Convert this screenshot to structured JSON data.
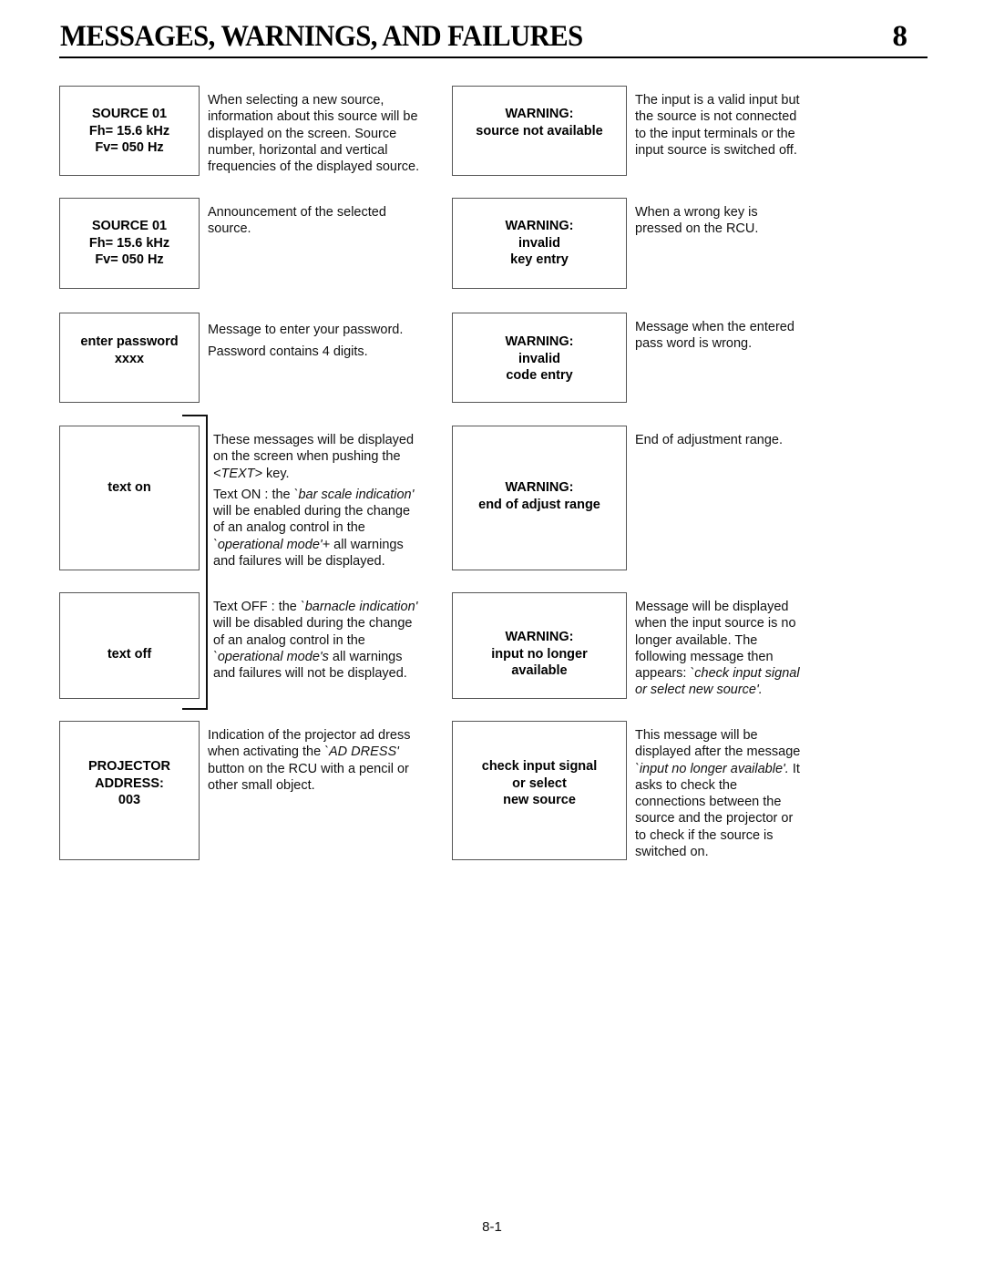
{
  "header": {
    "title": "MESSAGES, WARNINGS, AND FAILURES",
    "chapter": "8"
  },
  "left_column": [
    {
      "box_lines": [
        "SOURCE 01",
        "Fh= 15.6 kHz",
        "Fv= 050 Hz"
      ],
      "description": [
        "When selecting a new source,",
        "information about this source will be",
        "displayed on the screen. Source",
        "number, horizontal and vertical",
        "frequencies of the displayed source."
      ]
    },
    {
      "box_lines": [
        "SOURCE 01",
        "Fh= 15.6 kHz",
        "Fv= 050 Hz"
      ],
      "description": [
        "Announcement of the selected",
        "source."
      ]
    },
    {
      "box_lines": [
        "enter password",
        "xxxx"
      ],
      "description": [
        "Message to enter your password.",
        "Password contains 4 digits."
      ]
    },
    {
      "box_lines": [
        "text on"
      ],
      "description_intro": {
        "line1": "These messages will be displayed",
        "line2": "on the screen when pushing the",
        "key_italic": "<TEXT>",
        "key_suffix": " key."
      },
      "description_detail": {
        "prefix": "Text ON : the ",
        "italic1": "`bar scale indication'",
        "line2": "will be enabled during the change",
        "line3": "of an analog control in the",
        "italic2": "`operational mode'+",
        "suffix2": " all warnings",
        "line5": "and failures will be displayed."
      }
    },
    {
      "box_lines": [
        "text off"
      ],
      "description_detail": {
        "prefix": "Text OFF : the ",
        "italic1": "`barnacle indication'",
        "line2": "will be disabled during the change",
        "line3": "of an analog control in the",
        "italic2": "`operational mode's",
        "suffix2": " all warnings",
        "line5": "and failures will not be displayed."
      }
    },
    {
      "box_lines": [
        "PROJECTOR",
        "ADDRESS:",
        "003"
      ],
      "description_detail": {
        "line1": "Indication of the projector ad dress",
        "prefix2": "when activating the ",
        "italic": "`AD DRESS'",
        "line3": "button on the RCU with a pencil or",
        "line4": "other small object."
      }
    }
  ],
  "right_column": [
    {
      "box_lines": [
        "WARNING:",
        "source not available"
      ],
      "description": [
        "The input is a valid input but",
        "the source is not connected",
        "to the input terminals or the",
        "input source is switched off."
      ]
    },
    {
      "box_lines": [
        "WARNING:",
        "invalid",
        "key entry"
      ],
      "description": [
        "When a wrong key is",
        "pressed on the RCU."
      ]
    },
    {
      "box_lines": [
        "WARNING:",
        "invalid",
        "code entry"
      ],
      "description": [
        "Message when the entered",
        "pass word is wrong."
      ]
    },
    {
      "box_lines": [
        "WARNING:",
        "end of adjust range"
      ],
      "description": [
        "End of adjustment range."
      ]
    },
    {
      "box_lines": [
        "WARNING:",
        "input no longer",
        "available"
      ],
      "description_detail": {
        "line1": "Message will be displayed",
        "line2": "when the input source is no",
        "line3": "longer available. The",
        "line4": "following message then",
        "prefix5": "appears: ",
        "italic5": "`check input signal",
        "italic6": "or select new source'."
      }
    },
    {
      "box_lines": [
        "check input signal",
        "or select",
        "new source"
      ],
      "description_detail": {
        "line1": "This message will be",
        "line2": "displayed after the message",
        "italic3": "`input no longer available'.",
        "suffix3": " It",
        "line4": "asks to check the",
        "line5": "connections between the",
        "line6": "source and the projector or",
        "line7": "to check if the source is",
        "line8": "switched on."
      }
    }
  ],
  "footer": {
    "page_number": "8-1"
  }
}
